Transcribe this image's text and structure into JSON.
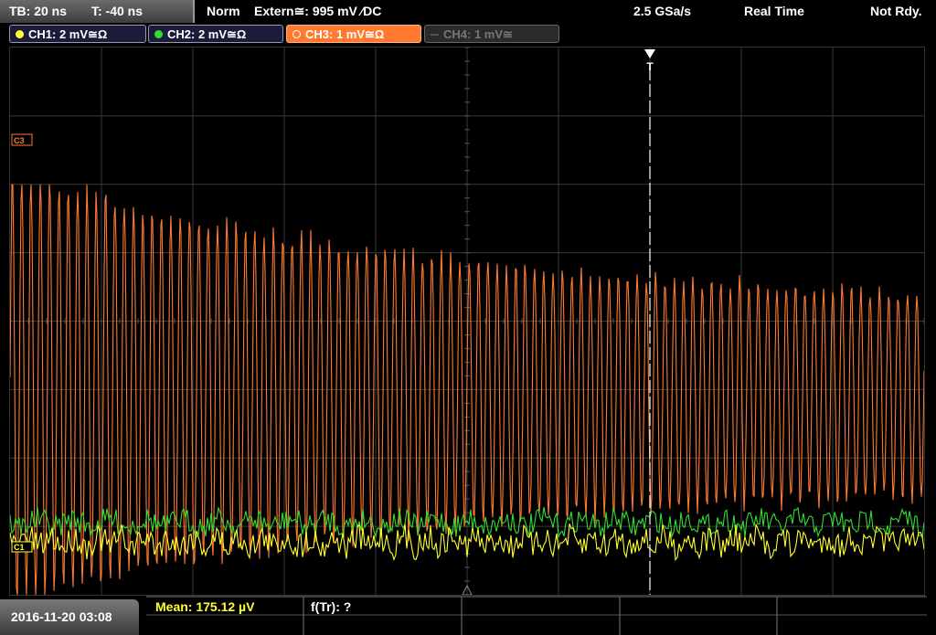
{
  "topbar": {
    "timebase": "TB: 20 ns",
    "trigger_time": "T: -40 ns",
    "trigger_mode": "Norm",
    "trigger_source": "Extern≅: 995 mV ⁄DC",
    "sample_rate": "2.5 GSa/s",
    "acq_mode": "Real Time",
    "status": "Not Rdy."
  },
  "channels": [
    {
      "label": "CH1: 2 mV≅Ω",
      "color": "#ffff33",
      "active": true
    },
    {
      "label": "CH2: 2 mV≅Ω",
      "color": "#33dd33",
      "active": true
    },
    {
      "label": "CH3: 1 mV≅Ω",
      "color": "#ff7a2e",
      "active": true,
      "selected": true
    },
    {
      "label": "CH4: 1 mV≅",
      "color": "#666666",
      "active": false
    }
  ],
  "markers": {
    "ch3_ref": "C3",
    "ch1_ref": "C1",
    "trigger": "T"
  },
  "measurements": {
    "mean": "Mean: 175.12 µV",
    "freq": "f(Tr): ?"
  },
  "timestamp": "2016-11-20 03:08",
  "colors": {
    "ch1": "#ffff33",
    "ch2": "#33dd33",
    "ch3": "#ff7a2e",
    "grid": "#3a3a3a",
    "trigger_line": "#ffffff"
  }
}
